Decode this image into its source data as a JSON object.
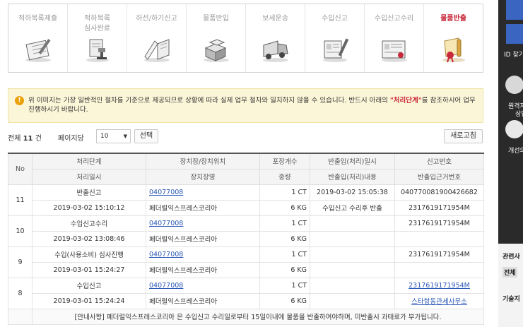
{
  "steps": [
    {
      "label": "적하목록제출",
      "icon": "clipboard-icon",
      "active": false
    },
    {
      "label": "적하목록\n심사완료",
      "icon": "document-stamp-icon",
      "active": false
    },
    {
      "label": "하선/하기신고",
      "icon": "open-book-icon",
      "active": false
    },
    {
      "label": "물품반입",
      "icon": "boxes-icon",
      "active": false
    },
    {
      "label": "보세운송",
      "icon": "truck-icon",
      "active": false
    },
    {
      "label": "수입신고",
      "icon": "form-pen-icon",
      "active": false
    },
    {
      "label": "수입신고수리",
      "icon": "certificate-icon",
      "active": false
    },
    {
      "label": "물품반출",
      "icon": "release-scroll-icon",
      "active": true
    }
  ],
  "notice": {
    "before": "위 이미지는 가장 일반적인 절차를 기준으로 제공되므로 상황에 따라 실제 업무 절차와 일치하지 않을 수 있습니다. 반드시 아래의 ",
    "highlight": "\"처리단계\"",
    "after": "를 참조하시어 업무 진행하시기 바랍니다."
  },
  "toolbar": {
    "total_prefix": "전체 ",
    "total_count": "11",
    "total_suffix": " 건",
    "per_page_label": "페이지당",
    "per_page_value": "10",
    "select_button": "선택",
    "refresh_button": "새로고침"
  },
  "table": {
    "headers_row1": [
      "처리단계",
      "장치장/장치위치",
      "포장개수",
      "반출입(처리)일시",
      "신고번호"
    ],
    "headers_row2": [
      "처리일시",
      "장치장명",
      "중량",
      "반출입(처리)내용",
      "반출입근거번호"
    ],
    "no_header": "No",
    "rows": [
      {
        "no": "11",
        "step": "반출신고",
        "location": "04077008",
        "count": "1 CT",
        "inout_datetime": "2019-03-02 15:05:38",
        "report_no": "040770081900426682",
        "proc_datetime": "2019-03-02 15:10:12",
        "warehouse": "페더럴익스프레스코리아",
        "weight": "6 KG",
        "inout_content": "수입신고 수리후 반출",
        "basis_no": "2317619171954M"
      },
      {
        "no": "10",
        "step": "수입신고수리",
        "location": "04077008",
        "count": "1 CT",
        "inout_datetime": "",
        "report_no": "2317619171954M",
        "proc_datetime": "2019-03-02 13:08:46",
        "warehouse": "페더럴익스프레스코리아",
        "weight": "6 KG",
        "inout_content": "",
        "basis_no": ""
      },
      {
        "no": "9",
        "step": "수입(사용소비) 심사진행",
        "location": "04077008",
        "count": "1 CT",
        "inout_datetime": "",
        "report_no": "2317619171954M",
        "proc_datetime": "2019-03-01 15:24:27",
        "warehouse": "페더럴익스프레스코리아",
        "weight": "6 KG",
        "inout_content": "",
        "basis_no": ""
      },
      {
        "no": "8",
        "step": "수입신고",
        "location": "04077008",
        "count": "1 CT",
        "inout_datetime": "",
        "report_no": "2317619171954M",
        "proc_datetime": "2019-03-01 15:24:24",
        "warehouse": "페더럴익스프레스코리아",
        "weight": "6 KG",
        "inout_content": "",
        "basis_no": "스타항동관세사무소"
      }
    ],
    "footer_notice": "[안내사항] 페더럴익스프레스코리아 은 수입신고 수리일로부터 15일이내에 물품을 반출하여야하며, 미반출시 과태료가 부가됩니다."
  },
  "sidebar": {
    "id_find": "ID 찾기",
    "remote": "원격지",
    "consult": "상담",
    "improve": "개선의",
    "related": "관련사",
    "all": "전체",
    "tech": "기술지"
  }
}
